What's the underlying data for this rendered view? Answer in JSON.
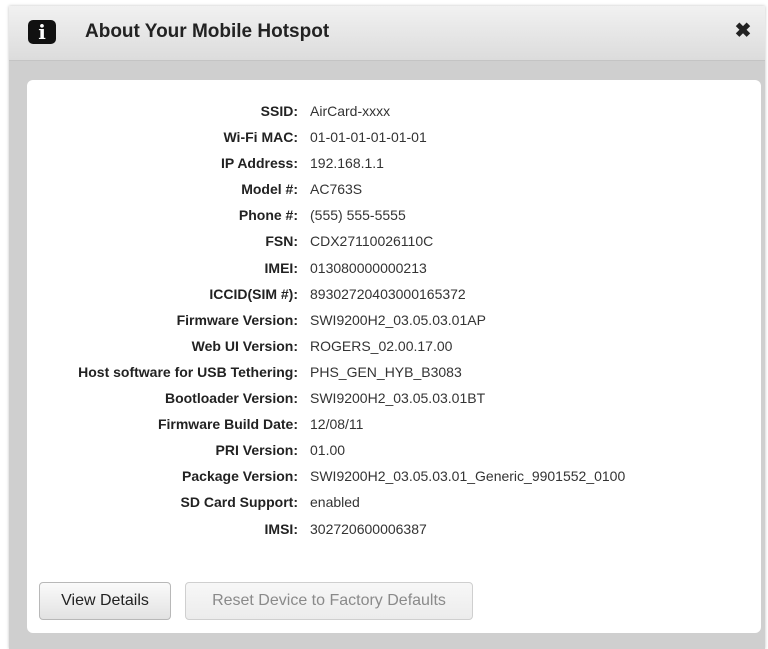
{
  "dialog": {
    "title": "About Your Mobile Hotspot",
    "info_icon_glyph": "i",
    "close_glyph": "✖"
  },
  "info_rows": [
    {
      "label": "SSID:",
      "value": "AirCard-xxxx"
    },
    {
      "label": "Wi-Fi MAC:",
      "value": "01-01-01-01-01-01"
    },
    {
      "label": "IP Address:",
      "value": "192.168.1.1"
    },
    {
      "label": "Model #:",
      "value": "AC763S"
    },
    {
      "label": "Phone #:",
      "value": "(555) 555-5555"
    },
    {
      "label": "FSN:",
      "value": "CDX27110026110C"
    },
    {
      "label": "IMEI:",
      "value": "013080000000213"
    },
    {
      "label": "ICCID(SIM #):",
      "value": "89302720403000165372"
    },
    {
      "label": "Firmware Version:",
      "value": "SWI9200H2_03.05.03.01AP"
    },
    {
      "label": "Web UI Version:",
      "value": "ROGERS_02.00.17.00"
    },
    {
      "label": "Host software for USB Tethering:",
      "value": "PHS_GEN_HYB_B3083"
    },
    {
      "label": "Bootloader Version:",
      "value": "SWI9200H2_03.05.03.01BT"
    },
    {
      "label": "Firmware Build Date:",
      "value": "12/08/11"
    },
    {
      "label": "PRI Version:",
      "value": "01.00"
    },
    {
      "label": "Package Version:",
      "value": "SWI9200H2_03.05.03.01_Generic_9901552_0100"
    },
    {
      "label": "SD Card Support:",
      "value": "enabled"
    },
    {
      "label": "IMSI:",
      "value": "302720600006387"
    }
  ],
  "buttons": {
    "view_details": "View Details",
    "reset_device": "Reset Device to Factory Defaults"
  },
  "icons": {
    "info": "info-icon",
    "close": "close-icon"
  }
}
